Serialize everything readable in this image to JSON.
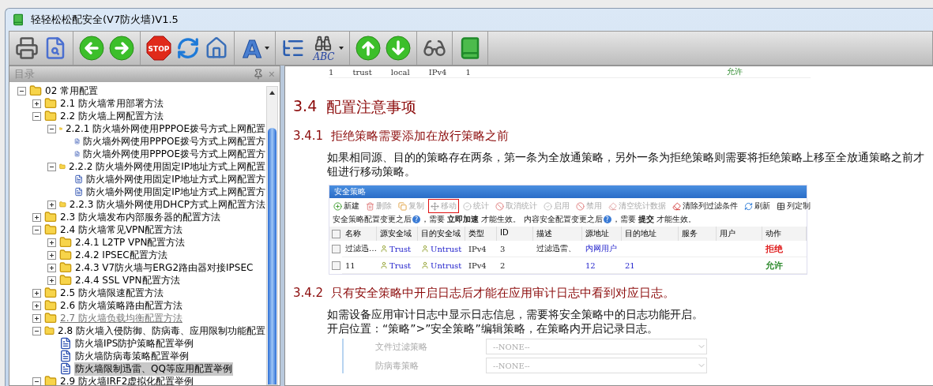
{
  "window": {
    "title": "轻轻松松配安全(V7防火墙)V1.5"
  },
  "toolbar": [
    [
      {
        "kind": "print"
      },
      {
        "kind": "preview"
      }
    ],
    [
      {
        "kind": "back"
      },
      {
        "kind": "forward"
      }
    ],
    [
      {
        "kind": "stop",
        "label": "STOP"
      },
      {
        "kind": "refresh"
      },
      {
        "kind": "home"
      }
    ],
    [
      {
        "kind": "font",
        "label": "A",
        "dropdown": true
      }
    ],
    [
      {
        "kind": "toc"
      },
      {
        "kind": "find",
        "label": "ABC",
        "dropdown": true
      }
    ],
    [
      {
        "kind": "up"
      },
      {
        "kind": "down"
      }
    ],
    [
      {
        "kind": "glasses"
      }
    ],
    [
      {
        "kind": "book"
      }
    ]
  ],
  "sidebar": {
    "title": "目录",
    "close": "×",
    "tree": [
      {
        "label": "02 常用配置",
        "kind": "folder",
        "expanded": true,
        "selected": false,
        "hover": false,
        "children": [
          {
            "label": "2.1 防火墙常用部署方法",
            "kind": "folder",
            "expanded": false,
            "selected": false,
            "hover": false
          },
          {
            "label": "2.2 防火墙上网配置方法",
            "kind": "folder",
            "expanded": true,
            "selected": false,
            "hover": false,
            "children": [
              {
                "label": "2.2.1 防火墙外网使用PPPOE拨号方式上网配置",
                "kind": "folder",
                "expanded": true,
                "selected": false,
                "hover": false,
                "children": [
                  {
                    "label": "防火墙外网使用PPPOE拨号方式上网配置方",
                    "kind": "doc",
                    "selected": false,
                    "hover": false
                  },
                  {
                    "label": "防火墙外网使用PPPOE拨号方式上网配置方",
                    "kind": "doc",
                    "selected": false,
                    "hover": false
                  }
                ]
              },
              {
                "label": "2.2.2 防火墙外网使用固定IP地址方式上网配置",
                "kind": "folder",
                "expanded": true,
                "selected": false,
                "hover": false,
                "children": [
                  {
                    "label": "防火墙外网使用固定IP地址方式上网配置方",
                    "kind": "doc",
                    "selected": false,
                    "hover": false
                  },
                  {
                    "label": "防火墙外网使用固定IP地址方式上网配置方",
                    "kind": "doc",
                    "selected": false,
                    "hover": false
                  }
                ]
              },
              {
                "label": "2.2.3 防火墙外网使用DHCP方式上网配置方法",
                "kind": "folder",
                "expanded": false,
                "selected": false,
                "hover": false
              }
            ]
          },
          {
            "label": "2.3 防火墙发布内部服务器的配置方法",
            "kind": "folder",
            "expanded": false,
            "selected": false,
            "hover": false
          },
          {
            "label": "2.4 防火墙常见VPN配置方法",
            "kind": "folder",
            "expanded": true,
            "selected": false,
            "hover": false,
            "children": [
              {
                "label": "2.4.1 L2TP VPN配置方法",
                "kind": "folder",
                "expanded": false,
                "selected": false,
                "hover": false
              },
              {
                "label": "2.4.2 IPSEC配置方法",
                "kind": "folder",
                "expanded": false,
                "selected": false,
                "hover": false
              },
              {
                "label": "2.4.3 V7防火墙与ERG2路由器对接IPSEC",
                "kind": "folder",
                "expanded": false,
                "selected": false,
                "hover": false
              },
              {
                "label": "2.4.4 SSL VPN配置方法",
                "kind": "folder",
                "expanded": false,
                "selected": false,
                "hover": false
              }
            ]
          },
          {
            "label": "2.5 防火墙限速配置方法",
            "kind": "folder",
            "expanded": false,
            "selected": false,
            "hover": false
          },
          {
            "label": "2.6 防火墙策略路由配置方法",
            "kind": "folder",
            "expanded": false,
            "selected": false,
            "hover": false
          },
          {
            "label": "2.7 防火墙负载均衡配置方法",
            "kind": "folder",
            "expanded": false,
            "selected": false,
            "hover": true
          },
          {
            "label": "2.8 防火墙入侵防御、防病毒、应用限制功能配置",
            "kind": "folder",
            "expanded": true,
            "selected": false,
            "hover": false,
            "children": [
              {
                "label": "防火墙IPS防护策略配置举例",
                "kind": "doc",
                "selected": false,
                "hover": false
              },
              {
                "label": "防火墙防病毒策略配置举例",
                "kind": "doc",
                "selected": false,
                "hover": false
              },
              {
                "label": "防火墙限制迅雷、QQ等应用配置举例",
                "kind": "doc",
                "selected": true,
                "hover": false
              }
            ]
          },
          {
            "label": "2.9 防火墙IRF2虚拟化配置举例",
            "kind": "folder",
            "expanded": true,
            "selected": false,
            "hover": false
          }
        ]
      }
    ]
  },
  "document": {
    "top_row": {
      "cells": [
        "1",
        "trust",
        "local",
        "IPv4",
        "1"
      ],
      "action": "允许"
    },
    "section": {
      "number": "3.4",
      "title": "配置注意事项"
    },
    "sub1": {
      "number": "3.4.1",
      "title": "拒绝策略需要添加在放行策略之前",
      "lines": [
        "如果相同源、目的的策略存在两条，第一条为全放通策略，另外一条为拒绝策略则需要将拒绝策略上移至全放通策略之前才",
        "钮进行移动策略。"
      ]
    },
    "policy_screenshot": {
      "title": "安全策略",
      "actions": [
        {
          "label": "新建",
          "kind": "add",
          "disabled": false,
          "highlighted": false
        },
        {
          "label": "删除",
          "kind": "delete",
          "disabled": true,
          "highlighted": false
        },
        {
          "label": "复制",
          "kind": "copy",
          "disabled": true,
          "highlighted": false
        },
        {
          "label": "移动",
          "kind": "move",
          "disabled": true,
          "highlighted": true
        },
        {
          "label": "统计",
          "kind": "check",
          "disabled": true,
          "highlighted": false
        },
        {
          "label": "取消统计",
          "kind": "ban",
          "disabled": true,
          "highlighted": false
        },
        {
          "label": "启用",
          "kind": "check",
          "disabled": true,
          "highlighted": false
        },
        {
          "label": "禁用",
          "kind": "ban",
          "disabled": true,
          "highlighted": false
        },
        {
          "label": "清空统计数据",
          "kind": "clear",
          "disabled": true,
          "highlighted": false
        },
        {
          "label": "清除列过滤条件",
          "kind": "clear",
          "disabled": false,
          "highlighted": false
        },
        {
          "label": "刷新",
          "kind": "refresh",
          "disabled": false,
          "highlighted": false
        },
        {
          "label": "列定制",
          "kind": "table",
          "disabled": false,
          "highlighted": false
        }
      ],
      "notice": [
        {
          "text": "安全策略配置变更之后",
          "help": "?"
        },
        {
          "text": "，需要 **立即加速** 才能生效。 内容安全配置变更之后",
          "help": "?"
        },
        {
          "text": "，需要 **提交** 才能生效。"
        }
      ],
      "select_all_checked": false,
      "columns": [
        "名称",
        "源安全域",
        "目的安全域",
        "类型",
        "ID",
        "描述",
        "源地址",
        "目的地址",
        "服务",
        "用户",
        "动作"
      ],
      "rows": [
        {
          "checked": false,
          "name": "过滤迅…",
          "src_zone": "Trust",
          "dst_zone": "Untrust",
          "type": "IPv4",
          "id": "3",
          "desc": "过滤迅雷、",
          "src_addr": "内网用户",
          "dst_addr": "",
          "action": {
            "text": "拒绝",
            "color": "#e02020"
          }
        },
        {
          "checked": false,
          "name": "11",
          "src_zone": "Trust",
          "dst_zone": "Untrust",
          "type": "IPv4",
          "id": "2",
          "desc": "",
          "src_addr": "12",
          "dst_addr": "21",
          "action": {
            "text": "允许",
            "color": "#2e8b2e"
          }
        }
      ]
    },
    "sub2": {
      "number": "3.4.2",
      "title": "只有安全策略中开启日志后才能在应用审计日志中看到对应日志。",
      "lines": [
        "如需设备应用审计日志中显示日志信息，需要将安全策略中的日志功能开启。",
        "开启位置：“策略”>”安全策略”编辑策略，在策略内开启记录日志。"
      ]
    },
    "form_screenshot": {
      "fields": [
        {
          "label": "文件过滤策略",
          "value": "--NONE--"
        },
        {
          "label": "防病毒策略",
          "value": "--NONE--"
        }
      ]
    }
  }
}
